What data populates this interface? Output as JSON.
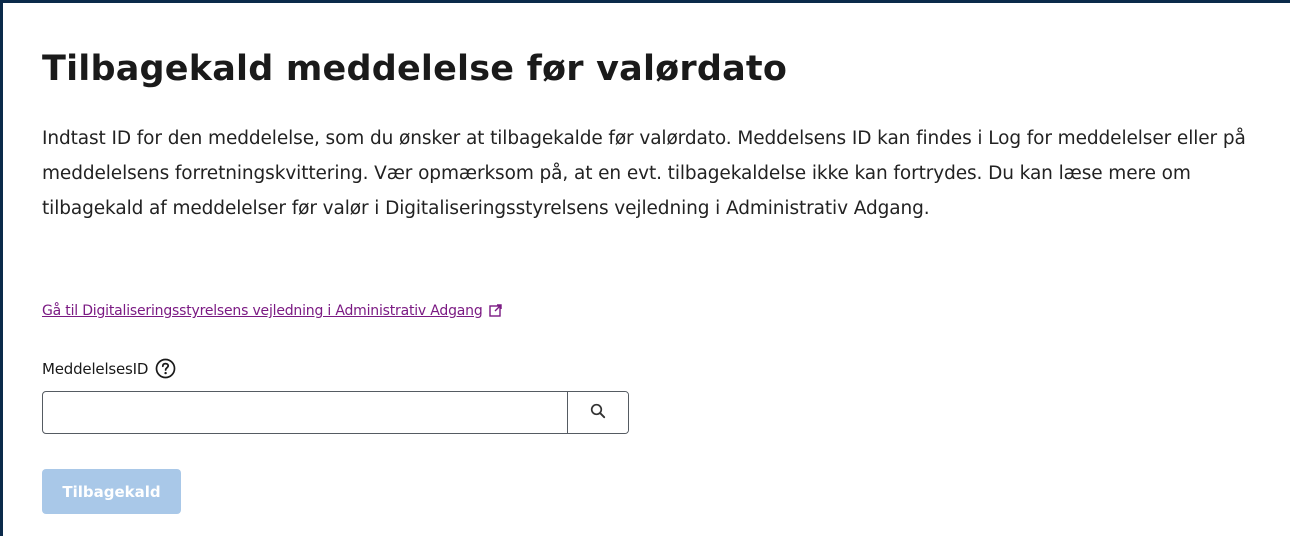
{
  "page": {
    "title": "Tilbagekald meddelelse før valørdato",
    "description": "Indtast ID for den meddelelse, som du ønsker at tilbagekalde før valørdato. Meddelsens ID kan findes i Log for meddelelser eller på meddelelsens forretningskvittering. Vær opmærksom på, at en evt. tilbagekaldelse ikke kan fortrydes. Du kan læse mere om tilbagekald af meddelelser før valør i Digitaliseringsstyrelsens vejledning i Administrativ Adgang."
  },
  "guide_link": {
    "label": "Gå til Digitaliseringsstyrelsens vejledning i Administrativ Adgang",
    "icon": "external-link-icon"
  },
  "message_id_field": {
    "label": "MeddelelsesID",
    "help_icon": "question-circle-icon",
    "value": "",
    "placeholder": "",
    "search_icon": "search-icon"
  },
  "submit_button": {
    "label": "Tilbagekald",
    "state": "disabled"
  },
  "colors": {
    "frame_border": "#0b2a4a",
    "link": "#7b1a83",
    "button_disabled": "#a9c8e8",
    "text": "#1a1a1a"
  }
}
